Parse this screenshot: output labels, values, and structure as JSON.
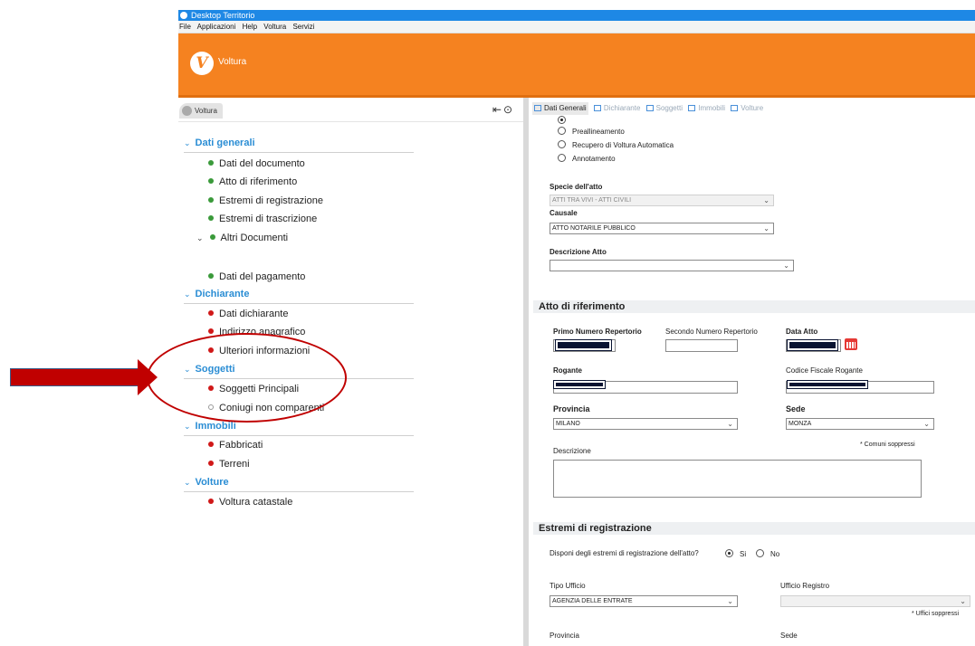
{
  "window": {
    "title": "Desktop Territorio"
  },
  "menu": [
    "File",
    "Applicazioni",
    "Help",
    "Voltura",
    "Servizi"
  ],
  "header": {
    "brand": "Voltura",
    "logo_letter": "V",
    "accent": "#f58220"
  },
  "left": {
    "tab_label": "Voltura",
    "sections": [
      {
        "label": "Dati generali"
      },
      {
        "label": "Dichiarante"
      },
      {
        "label": "Soggetti"
      },
      {
        "label": "Immobili"
      },
      {
        "label": "Volture"
      }
    ],
    "items": [
      "Dati del documento",
      "Atto di riferimento",
      "Estremi di registrazione",
      "Estremi di trascrizione",
      "Altri Documenti",
      "Dati del pagamento",
      "Dati dichiarante",
      "Indirizzo anagrafico",
      "Ulteriori informazioni",
      "Soggetti Principali",
      "Coniugi non comparenti",
      "Fabbricati",
      "Terreni",
      "Voltura catastale"
    ]
  },
  "tabs": [
    "Dati Generali",
    "Dichiarante",
    "Soggetti",
    "Immobili",
    "Volture"
  ],
  "form": {
    "radio_options": [
      "Preallineamento",
      "Recupero di Voltura Automatica",
      "Annotamento"
    ],
    "specie_label": "Specie dell'atto",
    "specie_value": "ATTI TRA VIVI - ATTI CIVILI",
    "causale_label": "Causale",
    "causale_value": "ATTO NOTARILE PUBBLICO",
    "descrizione_atto_label": "Descrizione Atto",
    "descrizione_atto_value": ""
  },
  "atto": {
    "heading": "Atto di riferimento",
    "primo_label": "Primo Numero Repertorio",
    "secondo_label": "Secondo Numero Repertorio",
    "data_label": "Data Atto",
    "rogante_label": "Rogante",
    "cf_label": "Codice Fiscale Rogante",
    "provincia_label": "Provincia",
    "provincia_value": "MILANO",
    "sede_label": "Sede",
    "sede_value": "MONZA",
    "comuni_note": "* Comuni soppressi",
    "descrizione_label": "Descrizione"
  },
  "estremi": {
    "heading": "Estremi di registrazione",
    "question": "Disponi degli estremi di registrazione dell'atto?",
    "yes": "Si",
    "no": "No",
    "tipo_label": "Tipo Ufficio",
    "tipo_value": "AGENZIA DELLE ENTRATE",
    "ufficio_label": "Ufficio Registro",
    "uffici_note": "* Uffici soppressi",
    "provincia_label": "Provincia",
    "sede_label": "Sede"
  }
}
